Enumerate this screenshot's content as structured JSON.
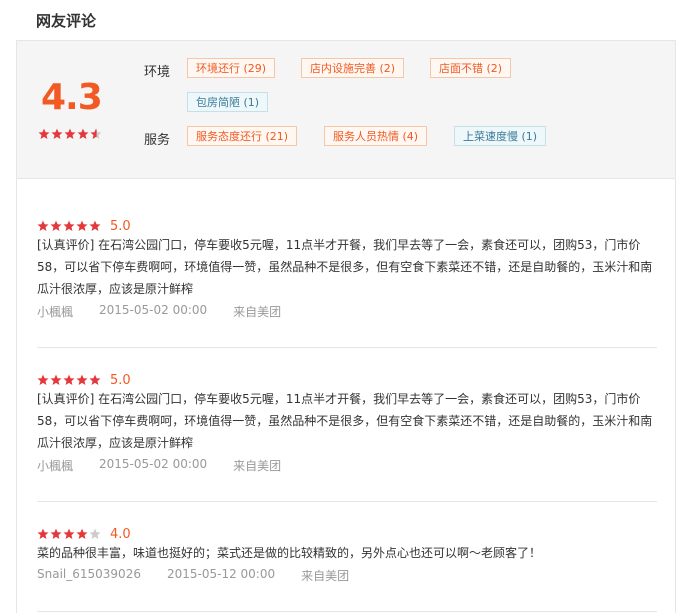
{
  "section": {
    "title": "网友评论"
  },
  "summary": {
    "score": "4.3",
    "score_stars": {
      "full": 4,
      "half": 1,
      "empty": 0
    },
    "categories": [
      {
        "label": "环境",
        "tags": [
          {
            "text": "环境还行 (29)",
            "type": "pos"
          },
          {
            "text": "店内设施完善 (2)",
            "type": "pos"
          },
          {
            "text": "店面不错 (2)",
            "type": "pos"
          },
          {
            "text": "包房简陋 (1)",
            "type": "neg"
          }
        ]
      },
      {
        "label": "服务",
        "tags": [
          {
            "text": "服务态度还行 (21)",
            "type": "pos"
          },
          {
            "text": "服务人员热情 (4)",
            "type": "pos"
          },
          {
            "text": "上菜速度慢 (1)",
            "type": "neg"
          }
        ]
      }
    ]
  },
  "reviews": [
    {
      "stars": 5,
      "score": "5.0",
      "text": "[认真评价] 在石湾公园门口，停车要收5元喔，11点半才开餐，我们早去等了一会，素食还可以，团购53，门市价58，可以省下停车费啊呵，环境值得一赞，虽然品种不是很多，但有空食下素菜还不错，还是自助餐的，玉米汁和南瓜汁很浓厚，应该是原汁鲜榨",
      "author": "小楓楓",
      "date": "2015-05-02 00:00",
      "source": "来自美团"
    },
    {
      "stars": 5,
      "score": "5.0",
      "text": "[认真评价] 在石湾公园门口，停车要收5元喔，11点半才开餐，我们早去等了一会，素食还可以，团购53，门市价58，可以省下停车费啊呵，环境值得一赞，虽然品种不是很多，但有空食下素菜还不错，还是自助餐的，玉米汁和南瓜汁很浓厚，应该是原汁鲜榨",
      "author": "小楓楓",
      "date": "2015-05-02 00:00",
      "source": "来自美团"
    },
    {
      "stars": 4,
      "score": "4.0",
      "text": "菜的品种很丰富，味道也挺好的；菜式还是做的比较精致的，另外点心也还可以啊～老顾客了！",
      "author": "Snail_615039026",
      "date": "2015-05-12 00:00",
      "source": "来自美团"
    }
  ],
  "colors": {
    "accent": "#f15a22",
    "star_full": "#e4393c",
    "star_empty": "#cccccc",
    "neg_tag": "#3b7a99"
  }
}
